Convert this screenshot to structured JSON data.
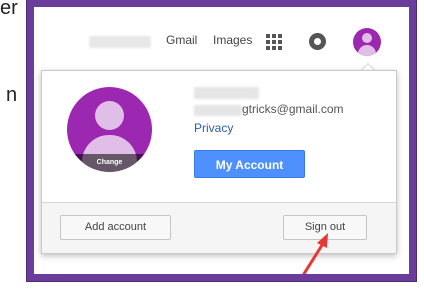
{
  "edge": {
    "top_fragment": "er",
    "mid_fragment": "n"
  },
  "header": {
    "gmail": "Gmail",
    "images": "Images",
    "apps_icon": "apps-grid-icon",
    "notif_icon": "notifications-icon"
  },
  "account": {
    "email_suffix": "gtricks@gmail.com",
    "privacy": "Privacy",
    "my_account": "My Account",
    "change_label": "Change"
  },
  "footer": {
    "add_account": "Add account",
    "sign_out": "Sign out"
  },
  "colors": {
    "frame": "#6a3d9a",
    "avatar": "#9c27b0",
    "button_blue": "#4d90fe",
    "arrow": "#e53935"
  }
}
